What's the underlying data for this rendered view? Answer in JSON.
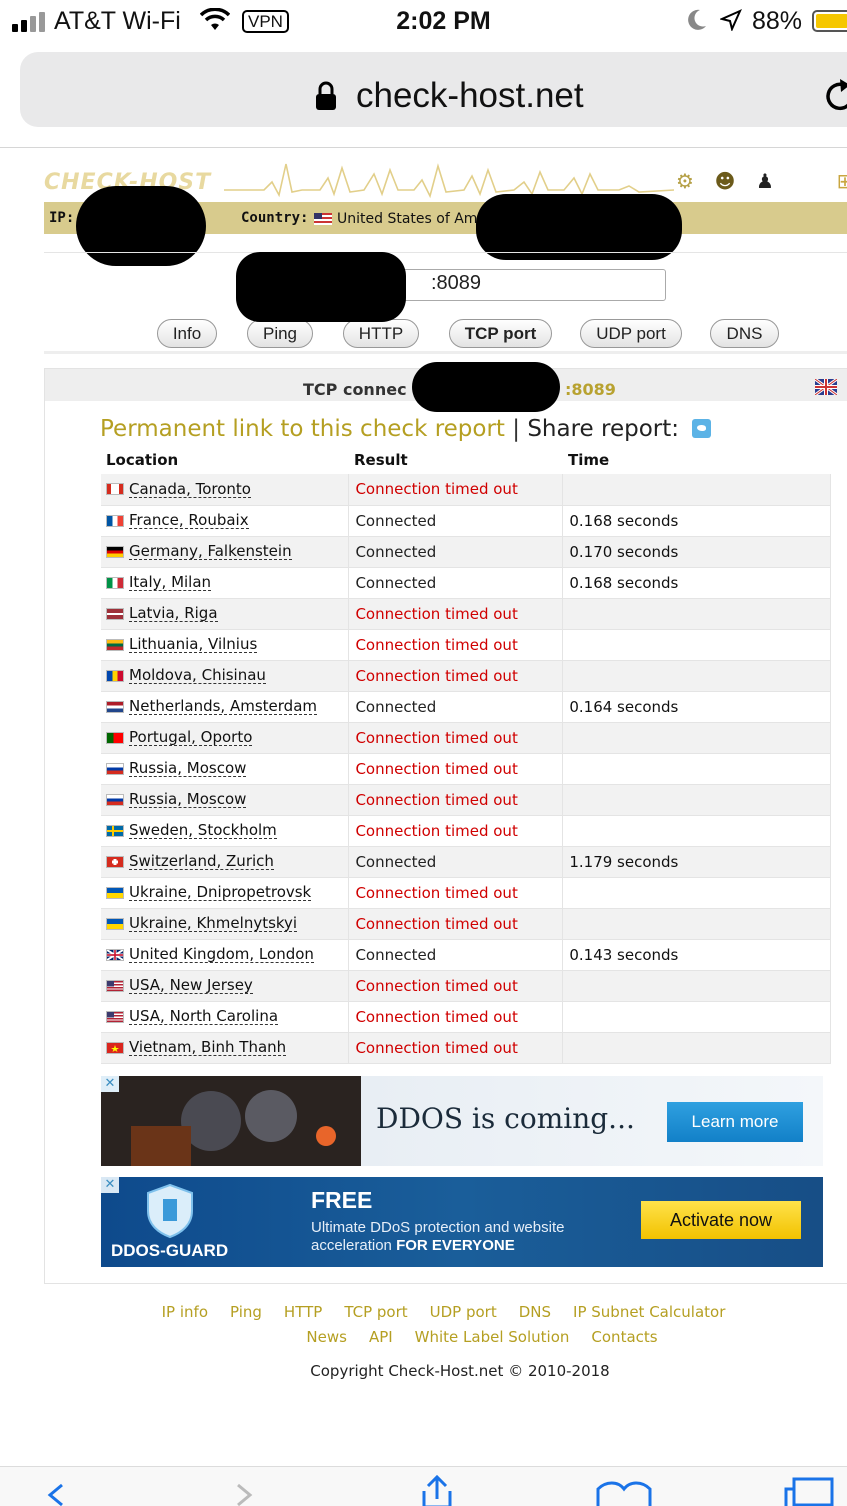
{
  "status_bar": {
    "carrier": "AT&T Wi-Fi",
    "vpn": "VPN",
    "time": "2:02 PM",
    "battery": "88%"
  },
  "browser": {
    "url": "check-host.net"
  },
  "header": {
    "logo": "CHECK-HOST",
    "ip_label": "IP:",
    "country_label": "Country:",
    "country": "United States of America"
  },
  "form": {
    "host_value": ":8089",
    "tabs": [
      "Info",
      "Ping",
      "HTTP",
      "TCP port",
      "UDP port",
      "DNS"
    ],
    "active_tab": "TCP port"
  },
  "report": {
    "title": "TCP connec",
    "port": ":8089",
    "permanent_link": "Permanent link to this check report",
    "separator": "|",
    "share": "Share report:",
    "columns": [
      "Location",
      "Result",
      "Time"
    ],
    "rows": [
      {
        "flag": "ca",
        "location": "Canada, Toronto",
        "result": "Connection timed out",
        "status": "timeout",
        "time": ""
      },
      {
        "flag": "fr",
        "location": "France, Roubaix",
        "result": "Connected",
        "status": "ok",
        "time": "0.168 seconds"
      },
      {
        "flag": "de",
        "location": "Germany, Falkenstein",
        "result": "Connected",
        "status": "ok",
        "time": "0.170 seconds"
      },
      {
        "flag": "it",
        "location": "Italy, Milan",
        "result": "Connected",
        "status": "ok",
        "time": "0.168 seconds"
      },
      {
        "flag": "lv",
        "location": "Latvia, Riga",
        "result": "Connection timed out",
        "status": "timeout",
        "time": ""
      },
      {
        "flag": "lt",
        "location": "Lithuania, Vilnius",
        "result": "Connection timed out",
        "status": "timeout",
        "time": ""
      },
      {
        "flag": "md",
        "location": "Moldova, Chisinau",
        "result": "Connection timed out",
        "status": "timeout",
        "time": ""
      },
      {
        "flag": "nl",
        "location": "Netherlands, Amsterdam",
        "result": "Connected",
        "status": "ok",
        "time": "0.164 seconds"
      },
      {
        "flag": "pt",
        "location": "Portugal, Oporto",
        "result": "Connection timed out",
        "status": "timeout",
        "time": ""
      },
      {
        "flag": "ru",
        "location": "Russia, Moscow",
        "result": "Connection timed out",
        "status": "timeout",
        "time": ""
      },
      {
        "flag": "ru",
        "location": "Russia, Moscow",
        "result": "Connection timed out",
        "status": "timeout",
        "time": ""
      },
      {
        "flag": "se",
        "location": "Sweden, Stockholm",
        "result": "Connection timed out",
        "status": "timeout",
        "time": ""
      },
      {
        "flag": "ch",
        "location": "Switzerland, Zurich",
        "result": "Connected",
        "status": "ok",
        "time": "1.179 seconds"
      },
      {
        "flag": "ua",
        "location": "Ukraine, Dnipropetrovsk",
        "result": "Connection timed out",
        "status": "timeout",
        "time": ""
      },
      {
        "flag": "ua",
        "location": "Ukraine, Khmelnytskyi",
        "result": "Connection timed out",
        "status": "timeout",
        "time": ""
      },
      {
        "flag": "gb",
        "location": "United Kingdom, London",
        "result": "Connected",
        "status": "ok",
        "time": "0.143 seconds"
      },
      {
        "flag": "us",
        "location": "USA, New Jersey",
        "result": "Connection timed out",
        "status": "timeout",
        "time": ""
      },
      {
        "flag": "us",
        "location": "USA, North Carolina",
        "result": "Connection timed out",
        "status": "timeout",
        "time": ""
      },
      {
        "flag": "vn",
        "location": "Vietnam, Binh Thanh",
        "result": "Connection timed out",
        "status": "timeout",
        "time": ""
      }
    ]
  },
  "ads": {
    "ad1_text": "DDOS is coming...",
    "ad1_button": "Learn more",
    "ad2_brand": "DDOS-GUARD",
    "ad2_headline": "FREE",
    "ad2_desc": "Ultimate DDoS protection and website acceleration",
    "ad2_desc_bold": "FOR EVERYONE",
    "ad2_button": "Activate now",
    "close": "✕"
  },
  "footer": {
    "links_row1": [
      "IP info",
      "Ping",
      "HTTP",
      "TCP port",
      "UDP port",
      "DNS",
      "IP Subnet Calculator"
    ],
    "links_row2": [
      "News",
      "API",
      "White Label Solution",
      "Contacts"
    ],
    "copyright": "Copyright Check-Host.net © 2010-2018"
  },
  "colors": {
    "accent_gold": "#b59f22",
    "timeout_red": "#d00000",
    "ip_bar": "#d8cb8d"
  }
}
